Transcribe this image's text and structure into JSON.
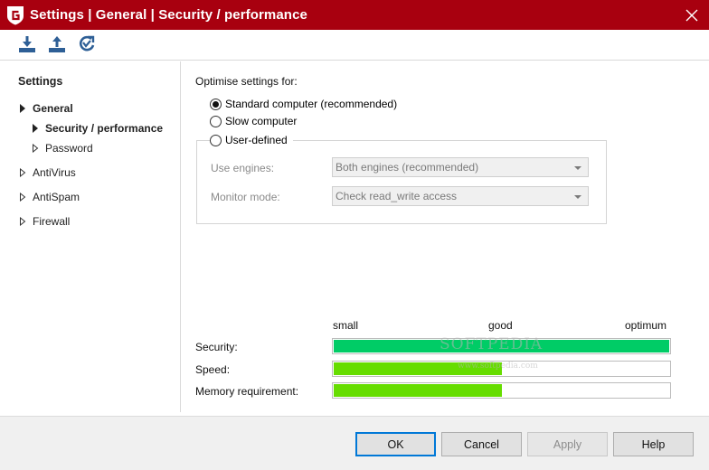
{
  "window": {
    "title": "Settings | General | Security / performance",
    "accent": "#a8000f"
  },
  "toolbar": {
    "icons": [
      "download-icon",
      "upload-icon",
      "restore-defaults-icon"
    ]
  },
  "sidebar": {
    "heading": "Settings",
    "items": [
      {
        "label": "General",
        "expanded": true
      },
      {
        "label": "Security / performance",
        "selected": true
      },
      {
        "label": "Password"
      },
      {
        "label": "AntiVirus"
      },
      {
        "label": "AntiSpam"
      },
      {
        "label": "Firewall"
      }
    ]
  },
  "main": {
    "optimise_label": "Optimise settings for:",
    "options": [
      {
        "label": "Standard computer (recommended)",
        "checked": true
      },
      {
        "label": "Slow computer",
        "checked": false
      },
      {
        "label": "User-defined",
        "checked": false
      }
    ],
    "engines_label": "Use engines:",
    "engines_value": "Both engines (recommended)",
    "monitor_label": "Monitor mode:",
    "monitor_value": "Check read_write access",
    "scale": {
      "low": "small",
      "mid": "good",
      "high": "optimum"
    },
    "metrics": [
      {
        "label": "Security:",
        "level": 1.0,
        "color": "#00cc66"
      },
      {
        "label": "Speed:",
        "level": 0.5,
        "color": "#66dd00"
      },
      {
        "label": "Memory requirement:",
        "level": 0.5,
        "color": "#66dd00"
      }
    ],
    "watermark": "SOFTPEDIA",
    "watermark_url": "www.softpedia.com"
  },
  "footer": {
    "ok": "OK",
    "cancel": "Cancel",
    "apply": "Apply",
    "help": "Help"
  }
}
